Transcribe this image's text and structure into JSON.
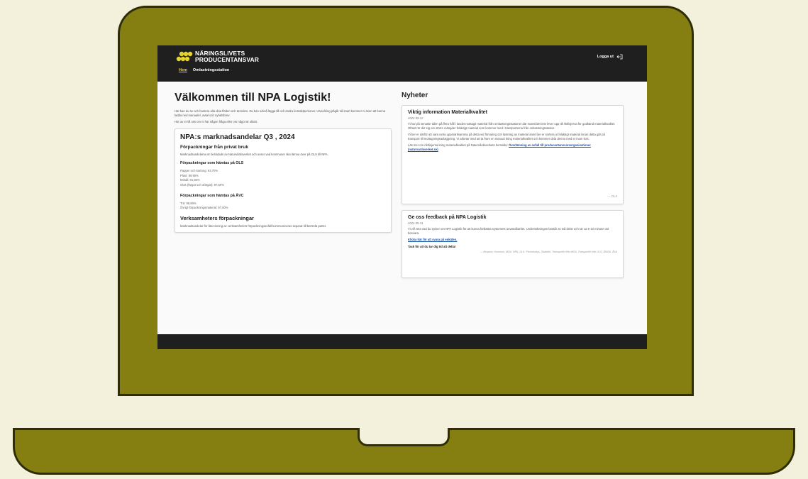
{
  "header": {
    "logo_line1": "NÄRINGSLIVETS",
    "logo_line2": "PRODUCENTANSVAR",
    "nav": [
      {
        "label": "Hem"
      },
      {
        "label": "Omlastningsstation"
      }
    ],
    "logout_label": "Logga ut"
  },
  "welcome": {
    "title": "Välkommen till NPA Logistik!",
    "intro": "Här kan du se och hantera alla dina flöden och ärenden. Du kan också lägga till och ändra kontaktpersoner. Utveckling pågår så snart kommer ni även att kunna ladda ned manualer, avtal och nyhetsbrev.",
    "contact": "Hör av er till oss om ni har någon fråga eller om något är oklart."
  },
  "market": {
    "title": "NPA:s marknadsandelar Q3 , 2024",
    "private_heading": "Förpackningar från privat bruk",
    "private_text": "Marknadsandelarna är beslutade av Naturvårdsverket och avser vad kommuner ska lämna över på OLS till NPA.",
    "ols_heading": "Förpackningar som hämtas på OLS",
    "ols_items": [
      "Papper och kartong: 93,70%",
      "Plast: 89,90%",
      "Metall: 91,60%",
      "Glas (färgat och ofärgat): 97,50%"
    ],
    "avc_heading": "Förpackningar som hämtas på ÅVC",
    "avc_items": [
      "Trä: 98,90%",
      "Övrigt förpackningsmaterial: 97,50%"
    ],
    "business_heading": "Verksamheters förpackningar",
    "business_text": "Marknadsandelar för återvinning av verksamheters förpackningsavfall kommuniceras separat till berörda parter."
  },
  "news": {
    "title": "Nyheter",
    "item1": {
      "title": "Viktig information Materialkvalitet",
      "date": "2024-09-12",
      "p1": "Vi har på senaste tiden på flera håll i landet mottagit material från omlastningsstationer där materialet inte lever upp till riktlinjerna för godkänd materialkvalitet. Oftast rör det sig om större mängder felaktigt material som kommer med i transporterna från omlastningsstation.",
      "p2": "Vi ber er därför att vara extra uppmärksamma på detta vid förvaring och lastning av material samt ber er sortera ut felaktigt material innan detta går på transport till mottagningsanläggning. Vi arbetar med att ta fram en manual kring materialkvalitet och kommer dela denna med er inom kort.",
      "p3_prefix": "Läs mer om riktlinjerna kring materialkvalitet på Naturvårdsverkets hemsida: ",
      "p3_link": "Överlämning av avfall till producentansvarsorganisationer (naturvardsverket.se)",
      "signature": "— OLS"
    },
    "item2": {
      "title": "Ge oss feedback på NPA Logistik",
      "date": "2024-05-31",
      "p1": "Vi vill veta vad du tycker om NPA Logistik för att kunna förbättra systemets användbarhet. Undersökningen består av två delar och tar ca 5-10 minuter att besvara.",
      "link": "Klicka här för att svara på enkäten.",
      "thanks": "Tack för att du tar dig tid att delta!",
      "signature": "— Bonprov, Kommun, MÖA, NPA, OLS, Plockanalys, Statistikr, Transportör från MÖA, Transportör från OLS, ÅMÖA, ÅVA"
    }
  },
  "colors": {
    "laptop": "#847f10",
    "outline": "#2f2d05",
    "background": "#f3f1dc",
    "header": "#1f1f1f",
    "nav_active": "#e6d22c",
    "link": "#1b53a8"
  }
}
